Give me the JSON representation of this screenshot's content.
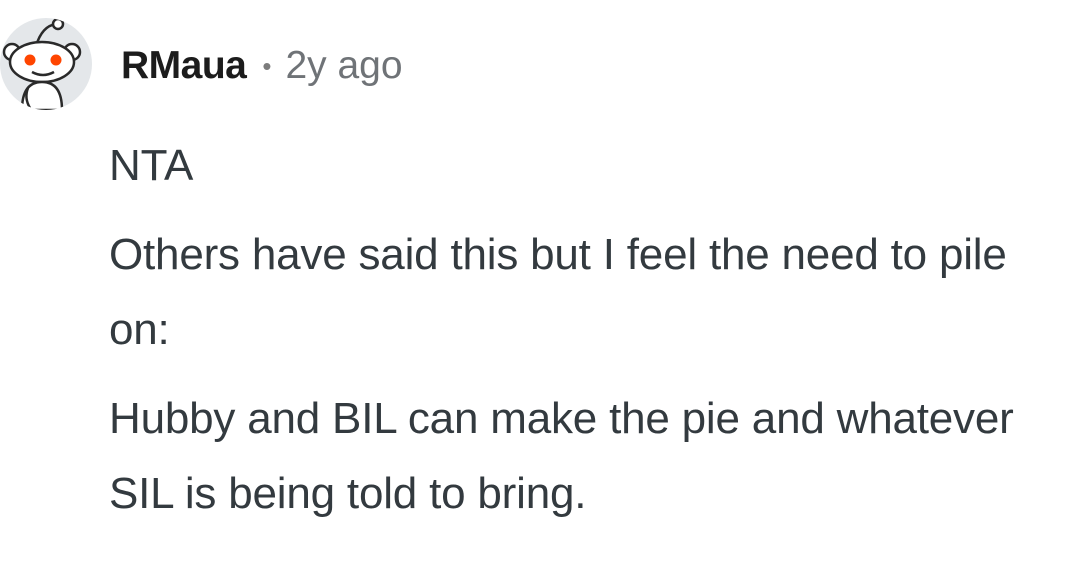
{
  "comment": {
    "avatar_icon": "reddit-snoo-avatar-icon",
    "username": "RMaua",
    "separator": "•",
    "timestamp": "2y ago",
    "paragraphs": [
      "NTA",
      "Others have said this but I feel the need to pile on:",
      "Hubby and BIL can make the pie and whatever SIL is being told to bring."
    ]
  },
  "colors": {
    "username": "#1c1c1c",
    "meta": "#6f7377",
    "body_text": "#333a3f",
    "avatar_bg": "#e4e7ea",
    "snoo_eye": "#ff4500"
  }
}
